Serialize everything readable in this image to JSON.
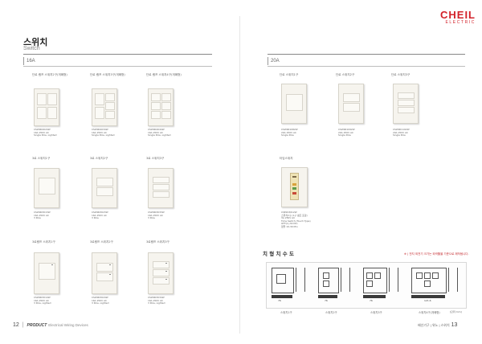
{
  "logo": {
    "main": "CHEIL",
    "sub": "ELECTRIC"
  },
  "page": {
    "title": "스위치",
    "subtitle": "Switch"
  },
  "tabs": {
    "left": "16A",
    "right": "20A"
  },
  "products16": [
    {
      "caption": "단로 램프 스위치2구(개폐형)"
    },
    {
      "caption": "단로 램프 스위치3구(개폐형)"
    },
    {
      "caption": "단로 램프 스위치4구(개폐형)"
    },
    {
      "caption": "3로 스위치1구"
    },
    {
      "caption": "3로 스위치2구"
    },
    {
      "caption": "3로 스위치3구"
    },
    {
      "caption": "3로램프 스위치1구"
    },
    {
      "caption": "3로램프 스위치2구"
    },
    {
      "caption": "3로램프 스위치3구"
    }
  ],
  "products20": [
    {
      "caption": "단로 스위치1구"
    },
    {
      "caption": "단로 스위치2구"
    },
    {
      "caption": "단로 스위치3구"
    },
    {
      "caption": "타임스위치"
    }
  ],
  "diagram": {
    "title": "치 형 치 수 도",
    "note": "※ | 전지 외전기 크기는 외곽틀을 기준으로 제작됩니다.",
    "labels": [
      "스위치1구",
      "스위치2구",
      "스위치3구",
      "스위치4구(개폐형)"
    ],
    "unit": "[단위:mm]"
  },
  "footer": {
    "left_num": "12",
    "left_cat": "PRODUCT",
    "left_text": "Electrical Wiring Devices",
    "right_text": "배선기구 | 위노 | 스위치",
    "right_num": "13"
  },
  "colors": {
    "brand": "#d3222a",
    "plate": "#f6f4ee"
  }
}
